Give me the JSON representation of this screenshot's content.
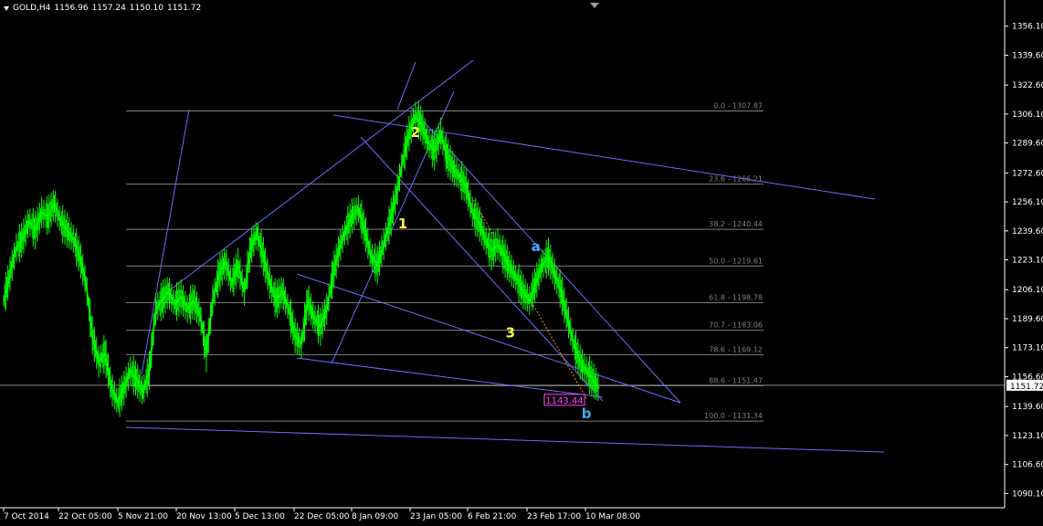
{
  "header": {
    "symbol": "GOLD,H4",
    "open": "1156.96",
    "high": "1157.24",
    "low": "1150.10",
    "close": "1151.72"
  },
  "colors": {
    "background": "#000000",
    "candles": "#00ff00",
    "axis": "#ffffff",
    "fib_lines": "#808080",
    "trend_lines": "#6b6bff",
    "wave_labels_yellow": "#ffff33",
    "wave_labels_blue": "#4aa6ff",
    "price_label": "#ff44ff",
    "dashed_orange": "#ff9900"
  },
  "chart_data": {
    "type": "line",
    "title": "",
    "ylim": [
      1082,
      1371
    ],
    "y_ticks": [
      1356.1,
      1339.6,
      1322.6,
      1306.1,
      1289.6,
      1272.6,
      1256.1,
      1239.6,
      1223.1,
      1206.1,
      1189.6,
      1173.1,
      1156.6,
      1139.6,
      1123.1,
      1106.6,
      1090.1
    ],
    "y_tick_labels": [
      "1356.10",
      "1339.60",
      "1322.60",
      "1306.10",
      "1289.60",
      "1272.60",
      "1256.10",
      "1239.60",
      "1223.10",
      "1206.10",
      "1189.60",
      "1173.10",
      "1156.60",
      "1139.60",
      "1123.10",
      "1106.60",
      "1090.10"
    ],
    "x_tick_labels": [
      "7 Oct 2014",
      "22 Oct 05:00",
      "5 Nov 21:00",
      "20 Nov 13:00",
      "5 Dec 13:00",
      "22 Dec 05:00",
      "8 Jan 09:00",
      "23 Jan 05:00",
      "6 Feb 21:00",
      "23 Feb 17:00",
      "10 Mar 08:00"
    ],
    "current_price": 1151.72,
    "current_price_label": "1151.72",
    "marked_price_label": "1143.44",
    "series": [
      {
        "values": [
          1200,
          1215,
          1230,
          1235,
          1245,
          1240,
          1250,
          1248,
          1255,
          1245,
          1240,
          1235,
          1225,
          1210,
          1180,
          1165,
          1170,
          1150,
          1142,
          1150,
          1160,
          1155,
          1148,
          1160,
          1195,
          1200,
          1205,
          1198,
          1202,
          1195,
          1200,
          1192,
          1170,
          1200,
          1215,
          1222,
          1210,
          1220,
          1205,
          1230,
          1238,
          1225,
          1210,
          1200,
          1205,
          1195,
          1180,
          1175,
          1200,
          1190,
          1185,
          1195,
          1215,
          1230,
          1240,
          1248,
          1252,
          1240,
          1225,
          1220,
          1232,
          1245,
          1260,
          1280,
          1295,
          1305,
          1300,
          1290,
          1285,
          1295,
          1282,
          1275,
          1270,
          1265,
          1250,
          1245,
          1235,
          1228,
          1232,
          1225,
          1218,
          1212,
          1205,
          1200,
          1210,
          1220,
          1225,
          1215,
          1205,
          1190,
          1175,
          1165,
          1160,
          1155,
          1150
        ]
      }
    ],
    "fib_levels": [
      {
        "label": "0.0 - 1307.87",
        "price": 1307.87
      },
      {
        "label": "23.6 - 1266.21",
        "price": 1266.21
      },
      {
        "label": "38.2 - 1240.44",
        "price": 1240.44
      },
      {
        "label": "50.0 - 1219.61",
        "price": 1219.61
      },
      {
        "label": "61.8 - 1198.78",
        "price": 1198.78
      },
      {
        "label": "70.7 - 1183.06",
        "price": 1183.06
      },
      {
        "label": "78.6 - 1169.12",
        "price": 1169.12
      },
      {
        "label": "88.6 - 1151.47",
        "price": 1151.47
      },
      {
        "label": "100.0 - 1131.34",
        "price": 1131.34
      }
    ],
    "wave_labels": [
      {
        "text": "2",
        "price": 1293,
        "index": 65,
        "color": "yellow"
      },
      {
        "text": "1",
        "price": 1241,
        "index": 63,
        "color": "yellow"
      },
      {
        "text": "3",
        "price": 1179,
        "index": 80,
        "color": "yellow"
      },
      {
        "text": "a",
        "price": 1228,
        "index": 84,
        "color": "blue"
      },
      {
        "text": "b",
        "price": 1133,
        "index": 92,
        "color": "blue"
      }
    ]
  }
}
